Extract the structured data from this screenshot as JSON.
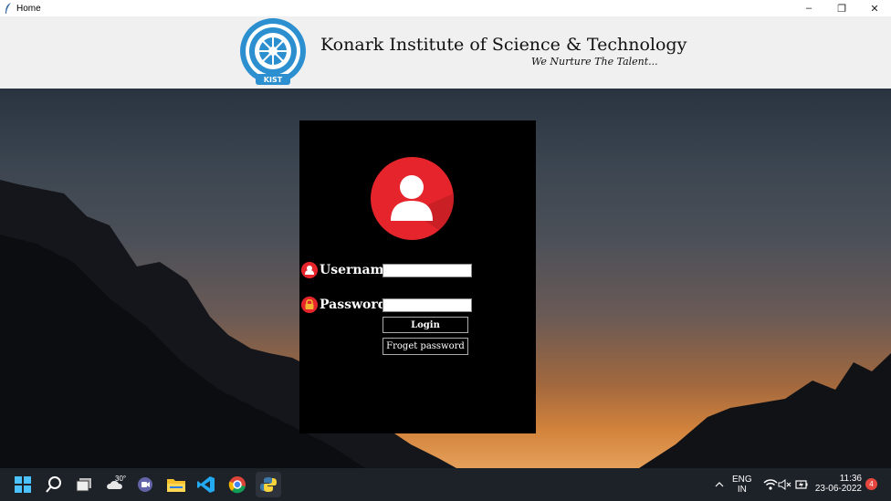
{
  "window": {
    "title": "Home",
    "minimize_glyph": "–",
    "maximize_glyph": "❐",
    "close_glyph": "✕"
  },
  "header": {
    "institute_name": "Konark Institute of Science & Technology",
    "tagline": "We Nurture The Talent..."
  },
  "login": {
    "username_label": "Username:",
    "username_value": "",
    "password_label": "Password:",
    "password_value": "",
    "login_button": "Login",
    "forgot_button": "Froget password"
  },
  "taskbar": {
    "weather_temp": "30°",
    "language_line1": "ENG",
    "language_line2": "IN",
    "time": "11:36",
    "date": "23-06-2022",
    "notification_count": "4"
  },
  "colors": {
    "accent_red": "#e5252b",
    "taskbar_bg": "#1d2128",
    "panel_bg": "#000000"
  }
}
